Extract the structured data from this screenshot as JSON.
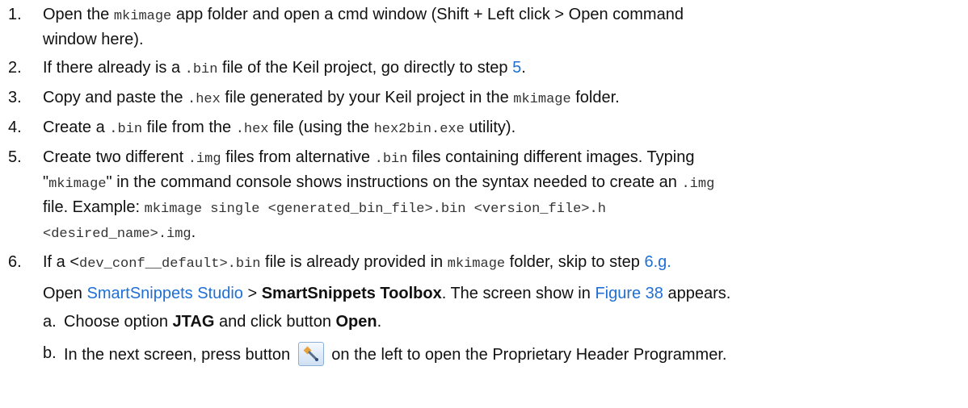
{
  "steps": [
    {
      "num": "1.",
      "t1": "Open the ",
      "c1": "mkimage",
      "t2": " app folder and open a cmd window (Shift + Left click > Open command",
      "t3": "window here)."
    },
    {
      "num": "2.",
      "t1": "If there already is a ",
      "c1": ".bin",
      "t2": " file of the Keil project, go directly to step ",
      "link": "5",
      "t3": "."
    },
    {
      "num": "3.",
      "t1": "Copy and paste the ",
      "c1": ".hex",
      "t2": " file generated by your Keil project in the ",
      "c2": "mkimage",
      "t3": " folder."
    },
    {
      "num": "4.",
      "t1": "Create a ",
      "c1": ".bin",
      "t2": " file from the ",
      "c2": ".hex",
      "t3": " file (using the ",
      "c3": "hex2bin.exe",
      "t4": " utility)."
    },
    {
      "num": "5.",
      "t1": "Create two different ",
      "c1": ".img",
      "t2": " files from alternative ",
      "c2": ".bin",
      "t3": " files containing different images. Typing",
      "t4": "\"",
      "c3": "mkimage",
      "t5": "\" in the command console shows instructions on the syntax needed to create an ",
      "c4": ".img",
      "t6": "file. Example: ",
      "c5": "mkimage single <generated_bin_file>.bin <version_file>.h",
      "c6": "<desired_name>.img",
      "t7": "."
    },
    {
      "num": "6.",
      "t1": "If a <",
      "c1": "dev_conf__default>.bin",
      "t2": " file is already provided in ",
      "c2": "mkimage",
      "t3": " folder, skip to step ",
      "link": "6.g.",
      "t4": "Open ",
      "link2": "SmartSnippets Studio",
      "t5": " > ",
      "b1": "SmartSnippets Toolbox",
      "t6": ". The screen show in ",
      "link3": "Figure 38",
      "t7": " appears."
    }
  ],
  "substeps": [
    {
      "num": "a.",
      "t1": "Choose option ",
      "b1": "JTAG",
      "t2": " and click button ",
      "b2": "Open",
      "t3": "."
    },
    {
      "num": "b.",
      "t1": "In the next screen, press button ",
      "t2": " on the left to open the Proprietary Header Programmer.",
      "icon": "proprietary-header-programmer-icon"
    }
  ]
}
